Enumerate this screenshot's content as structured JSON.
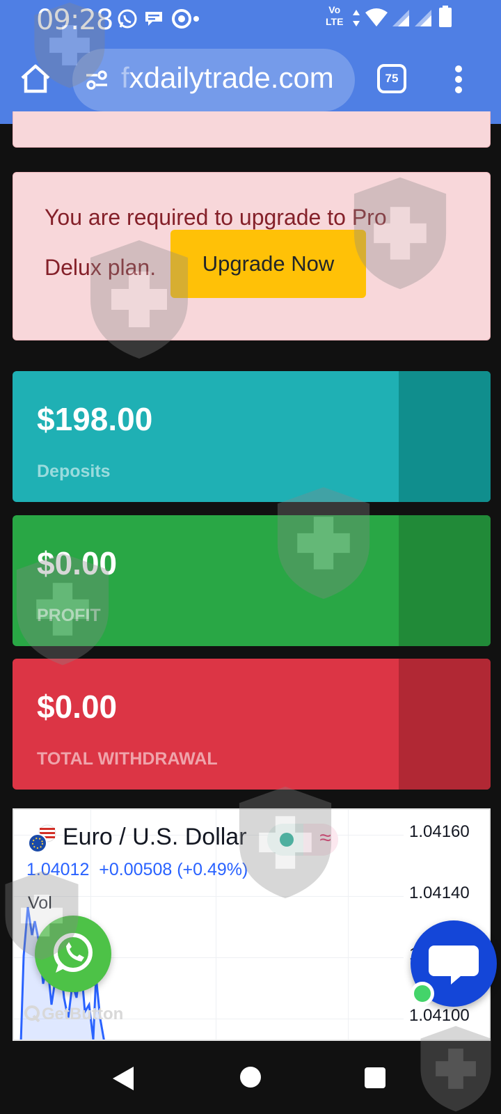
{
  "status_bar": {
    "time": "09:28",
    "network": "Vo\nLTE",
    "network_line1": "Vo",
    "network_line2": "LTE",
    "icons": [
      "whatsapp-icon",
      "chat-bubble-icon",
      "chrome-icon",
      "dot-icon",
      "data-arrows-icon",
      "wifi-icon",
      "signal-icon",
      "signal-icon",
      "battery-icon"
    ]
  },
  "browser": {
    "url_faded": "f",
    "url": "xdailytrade.com",
    "tab_count": "75",
    "icons": [
      "home-icon",
      "site-settings-icon",
      "tabs-icon",
      "more-vert-icon"
    ]
  },
  "alert": {
    "message_part1": "You are required to upgrade to Pro",
    "message_part2": "Delux plan.",
    "button_label": "Upgrade Now"
  },
  "cards": [
    {
      "amount": "$198.00",
      "label": "Deposits",
      "color": "#1fb0b4"
    },
    {
      "amount": "$0.00",
      "label": "PROFIT",
      "color": "#29a745"
    },
    {
      "amount": "$0.00",
      "label": "TOTAL WITHDRAWAL",
      "color": "#dc3545"
    }
  ],
  "ticker": {
    "pair": "Euro / U.S. Dollar",
    "price": "1.04012",
    "change": "+0.00508 (+0.49%)",
    "vol_label": "Vol",
    "axis_ticks": [
      "1.04160",
      "1.04140",
      "1",
      "1.04100"
    ],
    "accent": "#2962ff"
  },
  "widgets": {
    "getbutton_label": "GetButton",
    "icons": [
      "whatsapp-icon",
      "chat-icon"
    ]
  },
  "nav": {
    "icons": [
      "back-icon",
      "home-icon",
      "recents-icon"
    ]
  }
}
